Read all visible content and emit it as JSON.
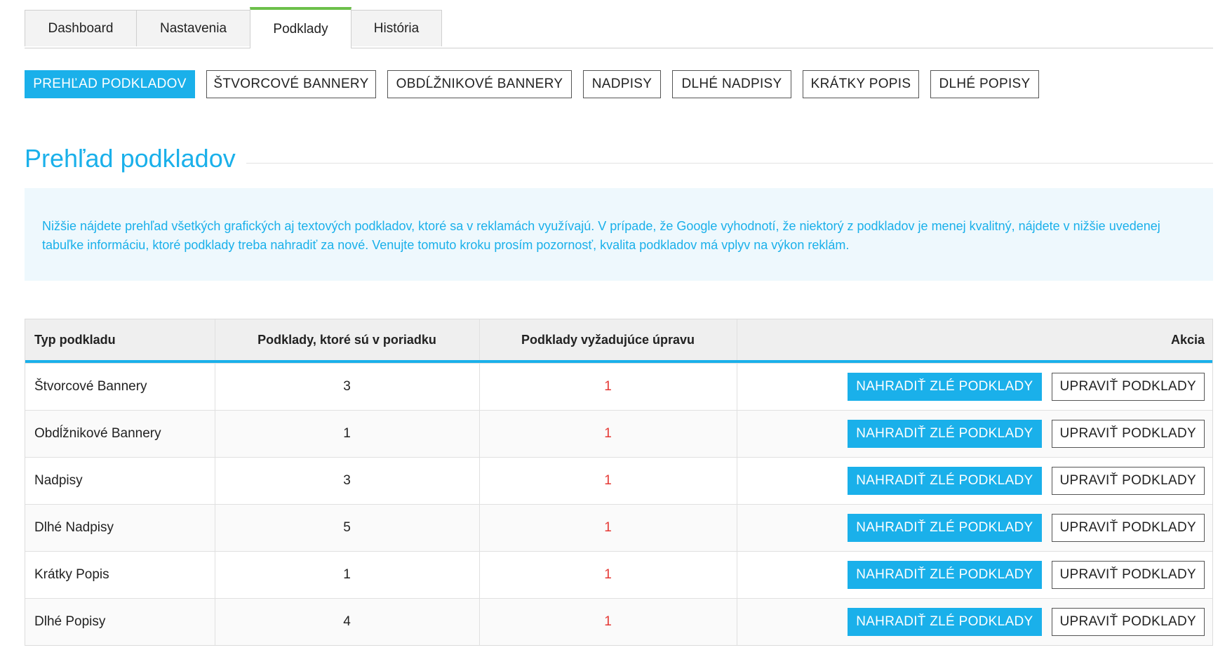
{
  "main_tabs": [
    {
      "label": "Dashboard",
      "active": false
    },
    {
      "label": "Nastavenia",
      "active": false
    },
    {
      "label": "Podklady",
      "active": true
    },
    {
      "label": "História",
      "active": false
    }
  ],
  "sub_tabs": [
    {
      "label": "PREHĽAD PODKLADOV",
      "active": true
    },
    {
      "label": "ŠTVORCOVÉ BANNERY",
      "active": false
    },
    {
      "label": "OBDĹŽNIKOVÉ BANNERY",
      "active": false
    },
    {
      "label": "NADPISY",
      "active": false
    },
    {
      "label": "DLHÉ NADPISY",
      "active": false
    },
    {
      "label": "KRÁTKY POPIS",
      "active": false
    },
    {
      "label": "DLHÉ POPISY",
      "active": false
    }
  ],
  "page_title": "Prehľad podkladov",
  "info_text": "Nižšie nájdete prehľad všetkých grafických aj textových podkladov, ktoré sa v reklamách využívajú. V prípade, že Google vyhodnotí, že niektorý z podkladov je menej kvalitný, nájdete v nižšie uvedenej tabuľke informáciu, ktoré podklady treba nahradiť za nové. Venujte tomuto kroku prosím pozornosť, kvalita podkladov má vplyv na výkon reklám.",
  "table": {
    "headers": {
      "type": "Typ podkladu",
      "ok": "Podklady, ktoré sú v poriadku",
      "needs_fix": "Podklady vyžadujúce úpravu",
      "action": "Akcia"
    },
    "replace_label": "NAHRADIŤ ZLÉ PODKLADY",
    "edit_label": "UPRAVIŤ PODKLADY",
    "rows": [
      {
        "type": "Štvorcové Bannery",
        "ok": "3",
        "needs_fix": "1"
      },
      {
        "type": "Obdĺžnikové Bannery",
        "ok": "1",
        "needs_fix": "1"
      },
      {
        "type": "Nadpisy",
        "ok": "3",
        "needs_fix": "1"
      },
      {
        "type": "Dlhé Nadpisy",
        "ok": "5",
        "needs_fix": "1"
      },
      {
        "type": "Krátky Popis",
        "ok": "1",
        "needs_fix": "1"
      },
      {
        "type": "Dlhé Popisy",
        "ok": "4",
        "needs_fix": "1"
      }
    ]
  },
  "colors": {
    "accent": "#1ab0ea",
    "tab_active_indicator": "#6cc04a",
    "warning_value": "#e53935"
  }
}
